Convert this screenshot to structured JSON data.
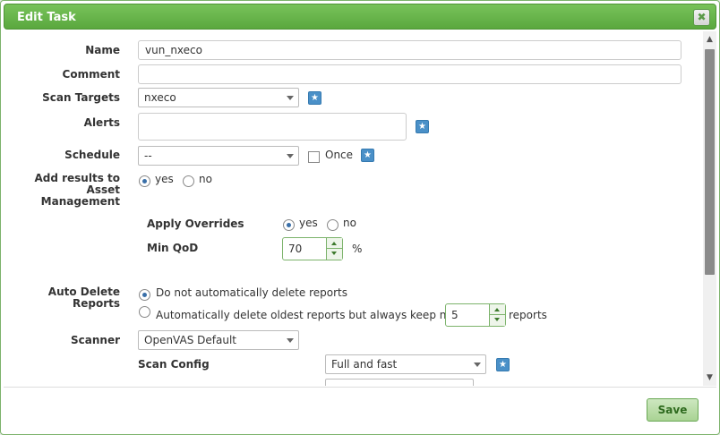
{
  "dialog": {
    "title": "Edit Task",
    "close_glyph": "✖"
  },
  "form": {
    "name": {
      "label": "Name",
      "value": "vun_nxeco"
    },
    "comment": {
      "label": "Comment",
      "value": ""
    },
    "scan_targets": {
      "label": "Scan Targets",
      "value": "nxeco"
    },
    "alerts": {
      "label": "Alerts",
      "value": ""
    },
    "schedule": {
      "label": "Schedule",
      "value": "--",
      "once_label": "Once"
    },
    "add_results": {
      "label_line1": "Add results to",
      "label_line2": "Asset",
      "label_line3": "Management",
      "yes": "yes",
      "no": "no",
      "selected": "yes"
    },
    "apply_overrides": {
      "label": "Apply Overrides",
      "yes": "yes",
      "no": "no",
      "selected": "yes"
    },
    "min_qod": {
      "label": "Min QoD",
      "value": "70",
      "unit": "%"
    },
    "auto_delete": {
      "label_line1": "Auto Delete",
      "label_line2": "Reports",
      "option1": "Do not automatically delete reports",
      "option2": "Automatically delete oldest reports but always keep newest",
      "keep_value": "5",
      "keep_suffix": "reports",
      "selected": "option1"
    },
    "scanner": {
      "label": "Scanner",
      "value": "OpenVAS Default"
    },
    "scan_config": {
      "label": "Scan Config",
      "value": "Full and fast"
    }
  },
  "footer": {
    "save_label": "Save"
  },
  "icons": {
    "star": "★",
    "close": "close-icon",
    "scroll_up": "▲",
    "scroll_down": "▼"
  },
  "colors": {
    "titlebar": "#5aa83e",
    "accent": "#4a90c8",
    "save_button": "#a9d393"
  }
}
